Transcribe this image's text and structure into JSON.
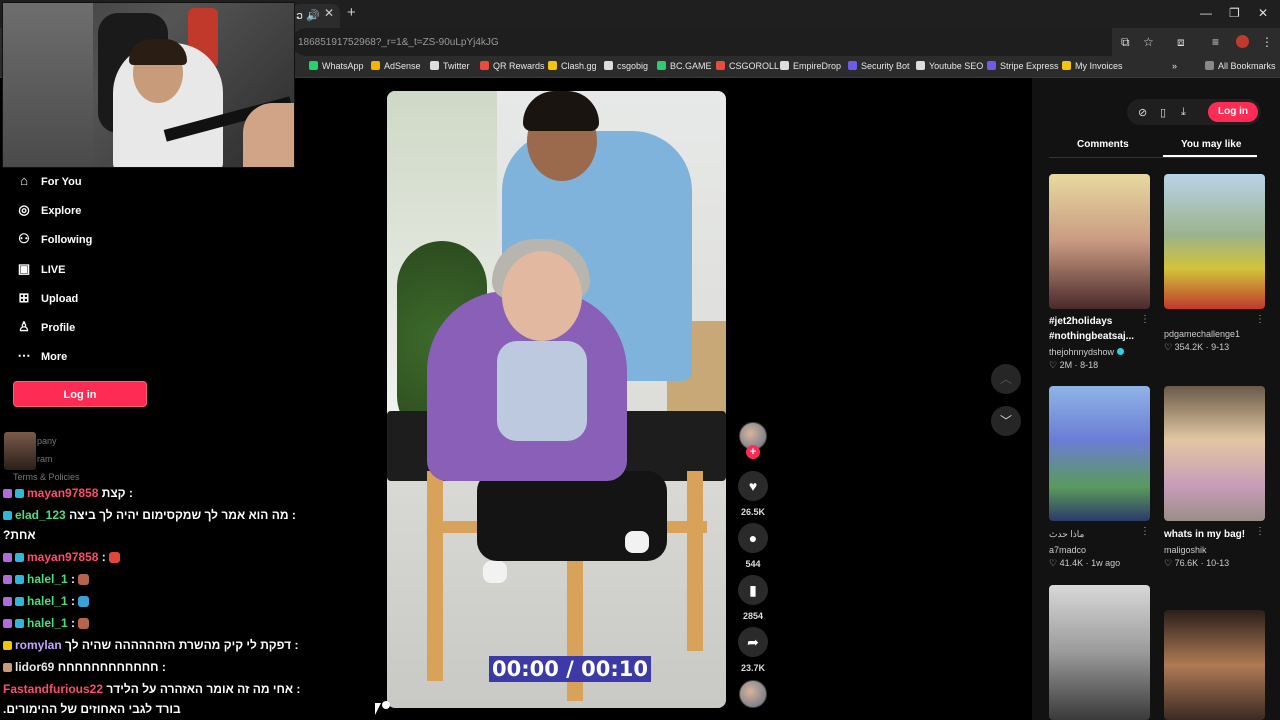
{
  "browser": {
    "tab_label": "ວ",
    "url": "186851917529​68?_r=1&_t=ZS-90uLpYj4kJG",
    "bookmarks": [
      {
        "label": "WhatsApp",
        "color": "#25d366"
      },
      {
        "label": "AdSense",
        "color": "#f4b400"
      },
      {
        "label": "Twitter",
        "color": "#ffffff"
      },
      {
        "label": "QR Rewards",
        "color": "#e74c3c"
      },
      {
        "label": "Clash.gg",
        "color": "#f1c40f"
      },
      {
        "label": "csgobig",
        "color": "#ffffff"
      },
      {
        "label": "BC.GAME",
        "color": "#2ecc71"
      },
      {
        "label": "CSGOROLL",
        "color": "#e74c3c"
      },
      {
        "label": "EmpireDrop",
        "color": "#ffffff"
      },
      {
        "label": "Security Bot",
        "color": "#6c5ce7"
      },
      {
        "label": "Youtube SEO",
        "color": "#ffffff"
      },
      {
        "label": "Stripe Express",
        "color": "#6c5ce7"
      },
      {
        "label": "My Invoices",
        "color": "#f1c40f"
      }
    ],
    "all_bookmarks": "All Bookmarks"
  },
  "nav": {
    "items": [
      {
        "label": "For You",
        "icon": "home-icon",
        "glyph": "⌂"
      },
      {
        "label": "Explore",
        "icon": "compass-icon",
        "glyph": "◎"
      },
      {
        "label": "Following",
        "icon": "people-icon",
        "glyph": "⚇"
      },
      {
        "label": "LIVE",
        "icon": "live-icon",
        "glyph": "▣"
      },
      {
        "label": "Upload",
        "icon": "upload-icon",
        "glyph": "⊞"
      },
      {
        "label": "Profile",
        "icon": "profile-icon",
        "glyph": "♙"
      },
      {
        "label": "More",
        "icon": "more-icon",
        "glyph": "⋯"
      }
    ],
    "login": "Log in",
    "footer_company": "pany",
    "footer_program": "ram",
    "footer_terms": "Terms & Policies"
  },
  "chat": [
    {
      "user": "mayan97858",
      "user_color": "#ff4d6d",
      "msg": "קצת :",
      "emote": ""
    },
    {
      "user": "elad_123",
      "user_color": "#4ade80",
      "msg": "מה הוא אמר לך שמקסימום יהיה לך ביצה :",
      "emote": ""
    },
    {
      "user": "",
      "user_color": "#fff",
      "msg": "?אחת",
      "emote": ""
    },
    {
      "user": "mayan97858",
      "user_color": "#ff4d6d",
      "msg": ":",
      "emote": "#e0463a"
    },
    {
      "user": "halel_1",
      "user_color": "#4ade80",
      "msg": ":",
      "emote": "#b5654a"
    },
    {
      "user": "halel_1",
      "user_color": "#4ade80",
      "msg": ":",
      "emote": "#3aa0d8"
    },
    {
      "user": "halel_1",
      "user_color": "#4ade80",
      "msg": ":",
      "emote": "#b5654a"
    },
    {
      "user": "romylan",
      "user_color": "#c7a4ff",
      "msg": "דפקת לי קיק מהשרת הזהההההה שהיה לך :",
      "emote": ""
    },
    {
      "user": "lidor69",
      "user_color": "#e6e6e6",
      "msg": "חחחחחחחחחחחח :",
      "emote": ""
    },
    {
      "user": "Fastandfurious22",
      "user_color": "#ff4d6d",
      "msg": "אחי מה זה אומר האזהרה על הלידר :",
      "emote": ""
    },
    {
      "user": "",
      "user_color": "#fff",
      "msg": ".בורד לגבי האחוזים של ההימורים",
      "emote": ""
    }
  ],
  "video": {
    "timecode": "00:00 / 00:10",
    "likes": "26.5K",
    "comments": "544",
    "saves": "2854",
    "shares": "23.7K"
  },
  "right_panel": {
    "login": "Log in",
    "tabs": [
      "Comments",
      "You may like"
    ],
    "active_tab": "You may like",
    "cards": [
      {
        "title": "#jet2holidays",
        "title2": "#nothingbeatsaj...",
        "author": "thejohnnydshow",
        "likes": "2M",
        "date": "8-18"
      },
      {
        "title": "",
        "title2": "",
        "author": "pdgamechallenge1",
        "likes": "354.2K",
        "date": "9-13"
      },
      {
        "title": "ماذا حدث",
        "title2": "",
        "author": "a7madco",
        "likes": "41.4K",
        "date": "1w ago"
      },
      {
        "title": "whats in my bag!",
        "title2": "",
        "author": "maligoshik",
        "likes": "76.6K",
        "date": "10-13"
      }
    ]
  }
}
